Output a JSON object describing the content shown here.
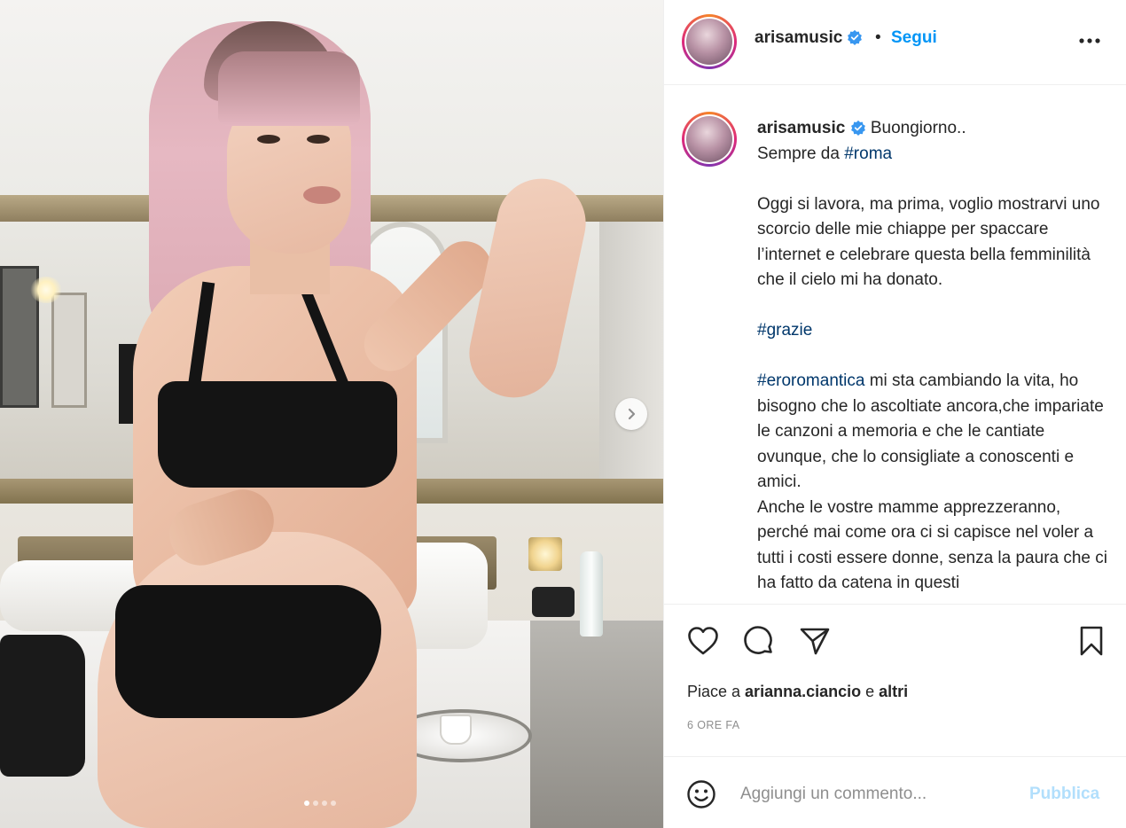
{
  "post": {
    "username": "arisamusic",
    "follow_label": "Segui",
    "bullet": "•",
    "more_label": "•••",
    "media_alt": "Foto del post",
    "carousel": {
      "total": 4,
      "active": 1
    }
  },
  "caption": {
    "username": "arisamusic",
    "lines": {
      "l1": "Buongiorno..",
      "l2_prefix": "Sempre da ",
      "l2_tag": "#roma",
      "p2": "Oggi si lavora, ma prima, voglio mostrarvi uno scorcio delle mie chiappe per spaccare l’internet e celebrare questa bella femminilità che il cielo mi ha donato.",
      "tag_grazie": "#grazie",
      "tag_eroromantica": "#eroromantica",
      "p4_rest": " mi sta cambiando la vita, ho bisogno che lo ascoltiate ancora,che impariate le canzoni a memoria e che le cantiate ovunque, che lo consigliate a conoscenti e amici.",
      "p5": "Anche le vostre mamme apprezzeranno, perché mai come ora ci si capisce nel voler a tutti i costi essere donne, senza la paura che ci ha fatto da catena in questi"
    }
  },
  "actions": {
    "likes_prefix": "Piace a ",
    "likes_user": "arianna.ciancio",
    "likes_mid": " e ",
    "likes_others": "altri",
    "timestamp": "6 ORE FA"
  },
  "comment": {
    "placeholder": "Aggiungi un commento...",
    "publish_label": "Pubblica"
  },
  "colors": {
    "link": "#0095f6",
    "hashtag": "#00376b",
    "publish_disabled": "#b2dffc",
    "muted": "#8e8e8e",
    "verified": "#3897f0"
  }
}
